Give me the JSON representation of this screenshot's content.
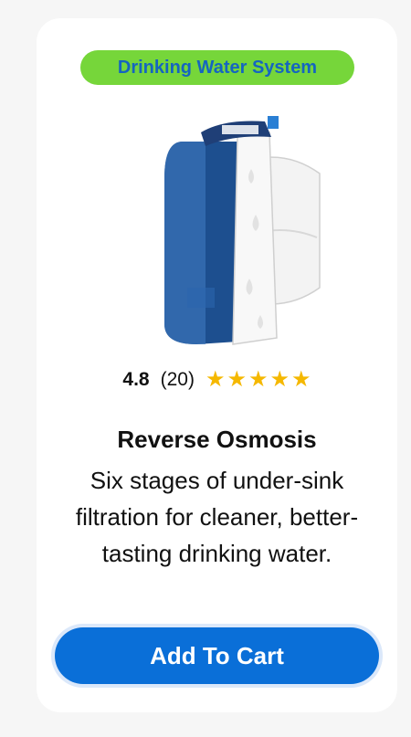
{
  "badge": {
    "label": "Drinking Water System"
  },
  "product": {
    "image_alt": "Reverse osmosis water filtration unit with storage tank",
    "rating": "4.8",
    "rating_count": "(20)",
    "stars": 5,
    "title": "Reverse Osmosis",
    "description": "Six stages of under-sink filtration for cleaner, better-tasting drinking water."
  },
  "actions": {
    "add_to_cart": "Add To Cart"
  },
  "colors": {
    "accent": "#0a6fd8",
    "badge_bg": "#76d63a",
    "badge_text": "#1565c0",
    "star": "#f5b800"
  }
}
